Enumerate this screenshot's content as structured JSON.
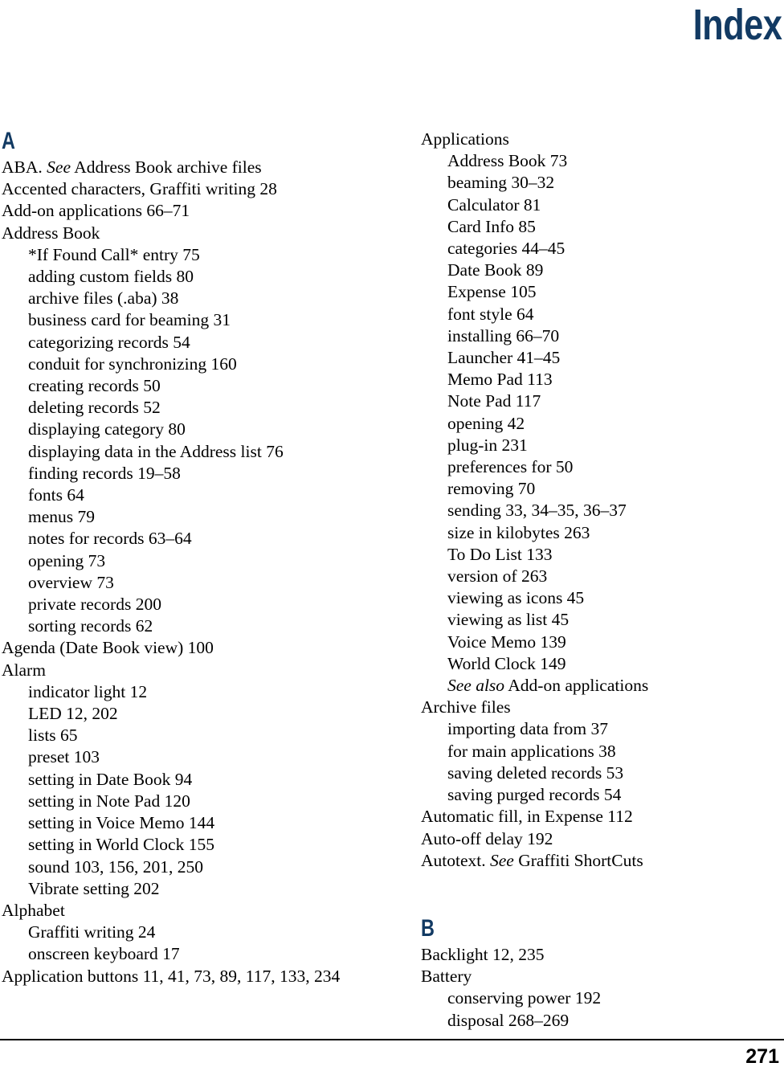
{
  "page": {
    "title": "Index",
    "number": "271",
    "accent_color": "#123A63"
  },
  "columns": [
    {
      "name": "left-column",
      "blocks": [
        {
          "heading": "A",
          "entries": [
            {
              "level": 0,
              "text": "ABA. ",
              "italic": "See",
              "text_after": " Address Book archive files"
            },
            {
              "level": 0,
              "text": "Accented characters, Graffiti writing  28"
            },
            {
              "level": 0,
              "text": "Add-on applications  66–71"
            },
            {
              "level": 0,
              "text": "Address Book"
            },
            {
              "level": 1,
              "text": "*If Found Call* entry  75"
            },
            {
              "level": 1,
              "text": "adding custom fields  80"
            },
            {
              "level": 1,
              "text": "archive files (.aba)  38"
            },
            {
              "level": 1,
              "text": "business card for beaming  31"
            },
            {
              "level": 1,
              "text": "categorizing records  54"
            },
            {
              "level": 1,
              "text": "conduit for synchronizing  160"
            },
            {
              "level": 1,
              "text": "creating records  50"
            },
            {
              "level": 1,
              "text": "deleting records  52"
            },
            {
              "level": 1,
              "text": "displaying category  80"
            },
            {
              "level": 1,
              "text": "displaying data in the Address list  76"
            },
            {
              "level": 1,
              "text": "finding records  19–58"
            },
            {
              "level": 1,
              "text": "fonts  64"
            },
            {
              "level": 1,
              "text": "menus  79"
            },
            {
              "level": 1,
              "text": "notes for records  63–64"
            },
            {
              "level": 1,
              "text": "opening  73"
            },
            {
              "level": 1,
              "text": "overview  73"
            },
            {
              "level": 1,
              "text": "private records  200"
            },
            {
              "level": 1,
              "text": "sorting records  62"
            },
            {
              "level": 0,
              "text": "Agenda (Date Book view)  100"
            },
            {
              "level": 0,
              "text": "Alarm"
            },
            {
              "level": 1,
              "text": "indicator light  12"
            },
            {
              "level": 1,
              "text": "LED  12, 202"
            },
            {
              "level": 1,
              "text": "lists  65"
            },
            {
              "level": 1,
              "text": "preset  103"
            },
            {
              "level": 1,
              "text": "setting in Date Book  94"
            },
            {
              "level": 1,
              "text": "setting in Note Pad  120"
            },
            {
              "level": 1,
              "text": "setting in Voice Memo  144"
            },
            {
              "level": 1,
              "text": "setting in World Clock  155"
            },
            {
              "level": 1,
              "text": "sound  103, 156, 201, 250"
            },
            {
              "level": 1,
              "text": "Vibrate setting  202"
            },
            {
              "level": 0,
              "text": "Alphabet"
            },
            {
              "level": 1,
              "text": "Graffiti writing  24"
            },
            {
              "level": 1,
              "text": "onscreen keyboard  17"
            },
            {
              "level": 0,
              "text": "Application buttons  11, 41, 73, 89, 117, 133, 234"
            }
          ]
        }
      ]
    },
    {
      "name": "right-column",
      "blocks": [
        {
          "heading": "",
          "entries": [
            {
              "level": 0,
              "text": "Applications"
            },
            {
              "level": 1,
              "text": "Address Book  73"
            },
            {
              "level": 1,
              "text": "beaming  30–32"
            },
            {
              "level": 1,
              "text": "Calculator  81"
            },
            {
              "level": 1,
              "text": "Card Info  85"
            },
            {
              "level": 1,
              "text": "categories  44–45"
            },
            {
              "level": 1,
              "text": "Date Book  89"
            },
            {
              "level": 1,
              "text": "Expense  105"
            },
            {
              "level": 1,
              "text": "font style  64"
            },
            {
              "level": 1,
              "text": "installing  66–70"
            },
            {
              "level": 1,
              "text": "Launcher  41–45"
            },
            {
              "level": 1,
              "text": "Memo Pad  113"
            },
            {
              "level": 1,
              "text": "Note Pad  117"
            },
            {
              "level": 1,
              "text": "opening  42"
            },
            {
              "level": 1,
              "text": "plug-in  231"
            },
            {
              "level": 1,
              "text": "preferences for  50"
            },
            {
              "level": 1,
              "text": "removing  70"
            },
            {
              "level": 1,
              "text": "sending  33, 34–35, 36–37"
            },
            {
              "level": 1,
              "text": "size in kilobytes  263"
            },
            {
              "level": 1,
              "text": "To Do List  133"
            },
            {
              "level": 1,
              "text": "version of  263"
            },
            {
              "level": 1,
              "text": "viewing as icons  45"
            },
            {
              "level": 1,
              "text": "viewing as list  45"
            },
            {
              "level": 1,
              "text": "Voice Memo  139"
            },
            {
              "level": 1,
              "text": "World Clock  149"
            },
            {
              "level": 1,
              "text": "",
              "italic": "See also",
              "text_after": " Add-on applications"
            },
            {
              "level": 0,
              "text": "Archive files"
            },
            {
              "level": 1,
              "text": "importing data from  37"
            },
            {
              "level": 1,
              "text": "for main applications  38"
            },
            {
              "level": 1,
              "text": "saving deleted records  53"
            },
            {
              "level": 1,
              "text": "saving purged records  54"
            },
            {
              "level": 0,
              "text": "Automatic fill, in Expense  112"
            },
            {
              "level": 0,
              "text": "Auto-off delay  192"
            },
            {
              "level": 0,
              "text": "Autotext. ",
              "italic": "See",
              "text_after": " Graffiti ShortCuts"
            }
          ]
        },
        {
          "heading": "B",
          "spaced": true,
          "entries": [
            {
              "level": 0,
              "text": "Backlight  12, 235"
            },
            {
              "level": 0,
              "text": "Battery"
            },
            {
              "level": 1,
              "text": "conserving power  192"
            },
            {
              "level": 1,
              "text": "disposal  268–269"
            }
          ]
        }
      ]
    }
  ]
}
